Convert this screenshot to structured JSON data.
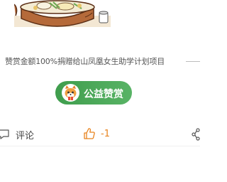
{
  "article": {
    "donation_note": "赞赏金额100%捐赠给山凤凰女生助学计划项目"
  },
  "reward": {
    "button_label": "公益赞赏",
    "accent_color": "#4caf50",
    "icon": "fox-mascot-icon"
  },
  "action_bar": {
    "comment_label": "评论",
    "comment_icon": "comment-icon",
    "like_count": "-1",
    "like_icon": "thumbs-up-icon",
    "like_color": "#e8831e",
    "share_icon": "share-icon"
  }
}
